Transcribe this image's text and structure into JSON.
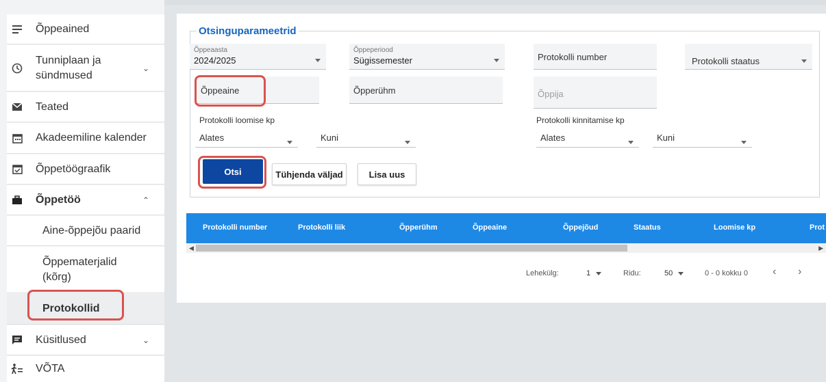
{
  "sidebar": {
    "items": [
      {
        "label": "Õppeained",
        "icon": "list-icon"
      },
      {
        "label": "Tunniplaan ja sündmused",
        "icon": "clock-icon"
      },
      {
        "label": "Teated",
        "icon": "mail-icon"
      },
      {
        "label": "Akadeemiline kalender",
        "icon": "calendar-icon"
      },
      {
        "label": "Õppetöögraafik",
        "icon": "calendar-check-icon"
      },
      {
        "label": "Õppetöö",
        "icon": "briefcase-icon"
      },
      {
        "label": "Aine-õppejõu paarid"
      },
      {
        "label": "Õppematerjalid (kõrg)"
      },
      {
        "label": "Protokollid"
      },
      {
        "label": "Küsitlused",
        "icon": "survey-icon"
      },
      {
        "label": "VÕTA",
        "icon": "walking-icon"
      }
    ]
  },
  "search": {
    "legend": "Otsinguparameetrid",
    "oppeaasta_label": "Õppeaasta",
    "oppeaasta_value": "2024/2025",
    "oppeperiood_label": "Õppeperiood",
    "oppeperiood_value": "Sügissemester",
    "protokolli_number_ph": "Protokolli number",
    "protokolli_staatus_ph": "Protokolli staatus",
    "oppeaine_ph": "Õppeaine",
    "opperuhm_ph": "Õpperühm",
    "oppija_ph": "Õppija",
    "loomise_label": "Protokolli loomise kp",
    "kinnitamise_label": "Protokolli kinnitamise kp",
    "alates": "Alates",
    "kuni": "Kuni",
    "btn_search": "Otsi",
    "btn_clear": "Tühjenda väljad",
    "btn_add": "Lisa uus"
  },
  "table": {
    "columns": [
      "Protokolli number",
      "Protokolli liik",
      "Õpperühm",
      "Õppeaine",
      "Õppejõud",
      "Staatus",
      "Loomise kp",
      "Prot"
    ]
  },
  "pagination": {
    "page_label": "Lehekülg:",
    "page_value": "1",
    "rows_label": "Ridu:",
    "rows_value": "50",
    "range": "0 - 0 kokku 0"
  },
  "colors": {
    "accent": "#1565c0",
    "table_header": "#1e88e5",
    "primary_button": "#0d47a1",
    "highlight": "#d9534f"
  }
}
